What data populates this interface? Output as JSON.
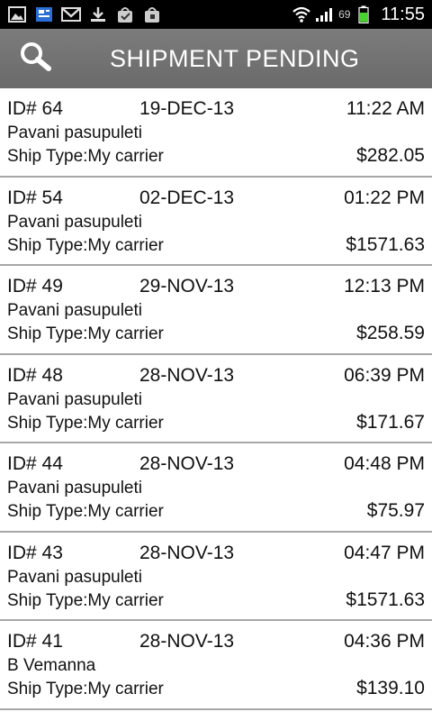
{
  "status_bar": {
    "left_icons": [
      "gallery-icon",
      "news-icon",
      "gmail-icon",
      "download-icon",
      "store-icon",
      "bag-icon"
    ],
    "battery_percent": "69",
    "time": "11:55"
  },
  "header": {
    "title": "SHIPMENT PENDING"
  },
  "shipments": [
    {
      "id": "ID# 64",
      "date": "19-DEC-13",
      "time": "11:22 AM",
      "name": "Pavani pasupuleti",
      "ship_type": "Ship Type:My carrier",
      "amount": "$282.05"
    },
    {
      "id": "ID# 54",
      "date": "02-DEC-13",
      "time": "01:22 PM",
      "name": "Pavani pasupuleti",
      "ship_type": "Ship Type:My carrier",
      "amount": "$1571.63"
    },
    {
      "id": "ID# 49",
      "date": "29-NOV-13",
      "time": "12:13 PM",
      "name": "Pavani pasupuleti",
      "ship_type": "Ship Type:My carrier",
      "amount": "$258.59"
    },
    {
      "id": "ID# 48",
      "date": "28-NOV-13",
      "time": "06:39 PM",
      "name": "Pavani pasupuleti",
      "ship_type": "Ship Type:My carrier",
      "amount": "$171.67"
    },
    {
      "id": "ID# 44",
      "date": "28-NOV-13",
      "time": "04:48 PM",
      "name": "Pavani pasupuleti",
      "ship_type": "Ship Type:My carrier",
      "amount": "$75.97"
    },
    {
      "id": "ID# 43",
      "date": "28-NOV-13",
      "time": "04:47 PM",
      "name": "Pavani pasupuleti",
      "ship_type": "Ship Type:My carrier",
      "amount": "$1571.63"
    },
    {
      "id": "ID# 41",
      "date": "28-NOV-13",
      "time": "04:36 PM",
      "name": "B Vemanna",
      "ship_type": "Ship Type:My carrier",
      "amount": "$139.10"
    }
  ]
}
